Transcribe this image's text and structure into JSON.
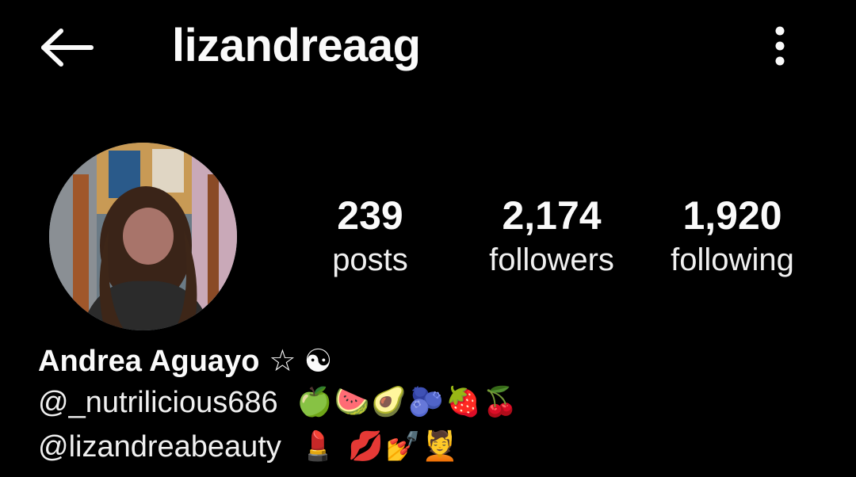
{
  "header": {
    "username": "lizandreaag",
    "back_icon": "arrow-left-icon",
    "menu_icon": "more-vertical-icon"
  },
  "avatar": {
    "alt": "profile-picture"
  },
  "stats": {
    "posts": {
      "value": "239",
      "label": "posts"
    },
    "followers": {
      "value": "2,174",
      "label": "followers"
    },
    "following": {
      "value": "1,920",
      "label": "following"
    }
  },
  "bio": {
    "name": "Andrea Aguayo",
    "name_star": "☆",
    "name_symbol": "☯",
    "line1_handle": "@_nutrilicious686",
    "line1_emojis": "🍏🍉🥑🫐🍓🍒",
    "line2_handle": "@lizandreabeauty",
    "line2_emojis": "💄 💋💅💆"
  },
  "colors": {
    "background": "#000000",
    "text": "#fafafa"
  }
}
